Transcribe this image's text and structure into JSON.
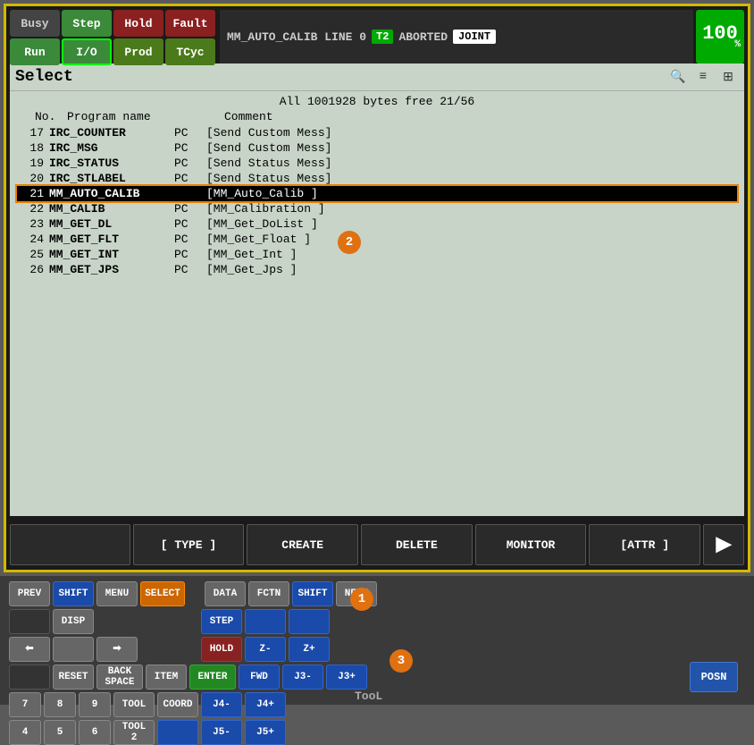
{
  "statusBar": {
    "buttons": [
      {
        "label": "Busy",
        "class": "btn-busy"
      },
      {
        "label": "Step",
        "class": "btn-step"
      },
      {
        "label": "Hold",
        "class": "btn-hold"
      },
      {
        "label": "Fault",
        "class": "btn-fault"
      },
      {
        "label": "Run",
        "class": "btn-run"
      },
      {
        "label": "I/O",
        "class": "btn-io"
      },
      {
        "label": "Prod",
        "class": "btn-prod"
      },
      {
        "label": "TCyc",
        "class": "btn-tcyc"
      }
    ],
    "message": "MM_AUTO_CALIB LINE 0",
    "tag": "T2",
    "aborted": "ABORTED",
    "joint": "JOINT",
    "percent": "100",
    "pctSign": "%"
  },
  "selectHeader": {
    "title": "Select"
  },
  "progList": {
    "infoLine": "All   1001928 bytes free          21/56",
    "colHeaders": {
      "no": "No.",
      "name": "Program name",
      "type": "",
      "comment": "Comment"
    },
    "rows": [
      {
        "no": "17",
        "name": "IRC_COUNTER",
        "type": "PC",
        "comment": "[Send Custom Mess]",
        "selected": false
      },
      {
        "no": "18",
        "name": "IRC_MSG",
        "type": "PC",
        "comment": "[Send Custom Mess]",
        "selected": false
      },
      {
        "no": "19",
        "name": "IRC_STATUS",
        "type": "PC",
        "comment": "[Send Status Mess]",
        "selected": false
      },
      {
        "no": "20",
        "name": "IRC_STLABEL",
        "type": "PC",
        "comment": "[Send Status Mess]",
        "selected": false
      },
      {
        "no": "21",
        "name": "MM_AUTO_CALIB",
        "type": "",
        "comment": "[MM_Auto_Calib    ]",
        "selected": true
      },
      {
        "no": "22",
        "name": "MM_CALIB",
        "type": "PC",
        "comment": "[MM_Calibration   ]",
        "selected": false
      },
      {
        "no": "23",
        "name": "MM_GET_DL",
        "type": "PC",
        "comment": "[MM_Get_DoList    ]",
        "selected": false
      },
      {
        "no": "24",
        "name": "MM_GET_FLT",
        "type": "PC",
        "comment": "[MM_Get_Float     ]",
        "selected": false
      },
      {
        "no": "25",
        "name": "MM_GET_INT",
        "type": "PC",
        "comment": "[MM_Get_Int       ]",
        "selected": false
      },
      {
        "no": "26",
        "name": "MM_GET_JPS",
        "type": "PC",
        "comment": "[MM_Get_Jps       ]",
        "selected": false
      }
    ]
  },
  "toolbar": {
    "buttons": [
      "[ TYPE ]",
      "CREATE",
      "DELETE",
      "MONITOR",
      "[ATTR ]"
    ]
  },
  "keyboard": {
    "rows": [
      [
        "PREV",
        "SHIFT",
        "MENU",
        "SELECT",
        "",
        "DATA",
        "FCTN",
        "SHIFT",
        "NEXT"
      ],
      [
        "",
        "",
        "",
        "",
        "",
        "STEP",
        "",
        "",
        ""
      ],
      [
        "",
        "⬅",
        "",
        "➡",
        "",
        "HOLD",
        "",
        "",
        ""
      ],
      [
        "",
        "RESET",
        "BACK SPACE",
        "ITEM",
        "ENTER",
        "FWD",
        "",
        "",
        ""
      ],
      [
        "7",
        "8",
        "9",
        "TOOL",
        "COORD",
        "",
        "",
        "",
        ""
      ],
      [
        "4",
        "5",
        "6",
        "TOOL 2",
        "",
        "",
        "",
        "",
        ""
      ]
    ]
  },
  "badges": [
    {
      "id": "1",
      "class": "badge-1"
    },
    {
      "id": "2",
      "class": "badge-2"
    },
    {
      "id": "3",
      "class": "badge-3"
    }
  ],
  "toolLabel": "TooL",
  "posnLabel": "POSN"
}
